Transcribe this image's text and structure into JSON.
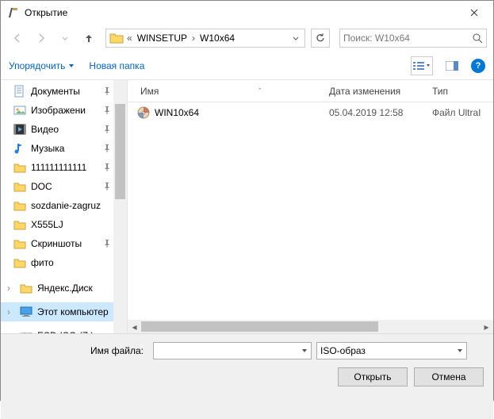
{
  "window": {
    "title": "Открытие"
  },
  "breadcrumb": {
    "prefix": "«",
    "seg1": "WINSETUP",
    "seg2": "W10x64"
  },
  "search": {
    "placeholder": "Поиск: W10x64"
  },
  "toolbar": {
    "organize": "Упорядочить",
    "newfolder": "Новая папка"
  },
  "columns": {
    "name": "Имя",
    "date": "Дата изменения",
    "type": "Тип"
  },
  "sidebar": {
    "items": [
      {
        "label": "Документы",
        "kind": "docs",
        "pinned": true
      },
      {
        "label": "Изображени",
        "kind": "images",
        "pinned": true
      },
      {
        "label": "Видео",
        "kind": "video",
        "pinned": true
      },
      {
        "label": "Музыка",
        "kind": "music",
        "pinned": true
      },
      {
        "label": "111111111111",
        "kind": "folder",
        "pinned": true
      },
      {
        "label": "DOC",
        "kind": "folder",
        "pinned": true
      },
      {
        "label": "sozdanie-zagruz",
        "kind": "folder",
        "pinned": false
      },
      {
        "label": "X555LJ",
        "kind": "folder",
        "pinned": false
      },
      {
        "label": "Скриншоты",
        "kind": "folder",
        "pinned": true
      },
      {
        "label": "фито",
        "kind": "folder",
        "pinned": false
      }
    ],
    "roots": [
      {
        "label": "Яндекс.Диск",
        "kind": "yadisk"
      },
      {
        "label": "Этот компьютер",
        "kind": "pc",
        "selected": true
      },
      {
        "label": "ESD-ISO (Z:)",
        "kind": "drive"
      }
    ]
  },
  "files": [
    {
      "name": "WIN10x64",
      "date": "05.04.2019 12:58",
      "type": "Файл UltraI"
    }
  ],
  "footer": {
    "filename_label": "Имя файла:",
    "filename_value": "",
    "filetype": "ISO-образ",
    "open": "Открыть",
    "cancel": "Отмена"
  }
}
